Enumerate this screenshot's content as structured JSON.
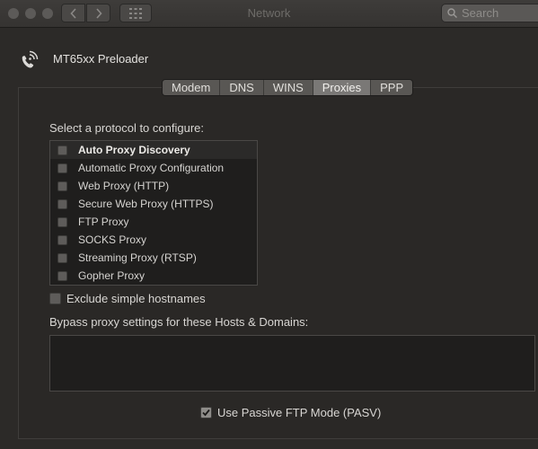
{
  "window": {
    "title": "Network",
    "search_placeholder": "Search"
  },
  "device": {
    "name": "MT65xx Preloader",
    "icon": "phone-icon"
  },
  "tabs": [
    {
      "label": "Modem",
      "active": false
    },
    {
      "label": "DNS",
      "active": false
    },
    {
      "label": "WINS",
      "active": false
    },
    {
      "label": "Proxies",
      "active": true
    },
    {
      "label": "PPP",
      "active": false
    }
  ],
  "protocols": {
    "heading": "Select a protocol to configure:",
    "items": [
      {
        "label": "Auto Proxy Discovery",
        "checked": false,
        "selected": true
      },
      {
        "label": "Automatic Proxy Configuration",
        "checked": false,
        "selected": false
      },
      {
        "label": "Web Proxy (HTTP)",
        "checked": false,
        "selected": false
      },
      {
        "label": "Secure Web Proxy (HTTPS)",
        "checked": false,
        "selected": false
      },
      {
        "label": "FTP Proxy",
        "checked": false,
        "selected": false
      },
      {
        "label": "SOCKS Proxy",
        "checked": false,
        "selected": false
      },
      {
        "label": "Streaming Proxy (RTSP)",
        "checked": false,
        "selected": false
      },
      {
        "label": "Gopher Proxy",
        "checked": false,
        "selected": false
      }
    ]
  },
  "exclude_simple": {
    "label": "Exclude simple hostnames",
    "checked": false
  },
  "bypass": {
    "label": "Bypass proxy settings for these Hosts & Domains:",
    "value": ""
  },
  "passive_ftp": {
    "label": "Use Passive FTP Mode (PASV)",
    "checked": true
  }
}
